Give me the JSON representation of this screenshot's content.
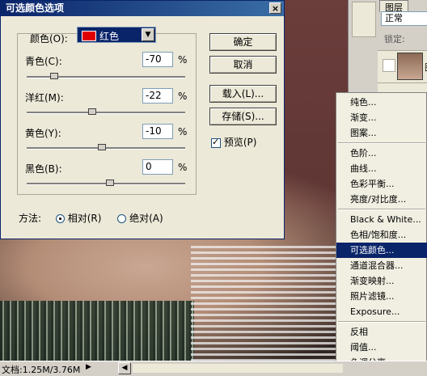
{
  "dialog": {
    "title": "可选颜色选项",
    "close": "×",
    "colors_label": "颜色(O):",
    "colors_value": "红色",
    "swatch_color": "#e00000",
    "rows": [
      {
        "label": "青色(C):",
        "value": "-70",
        "unit": "%",
        "level": -70
      },
      {
        "label": "洋红(M):",
        "value": "-22",
        "unit": "%",
        "level": -22
      },
      {
        "label": "黄色(Y):",
        "value": "-10",
        "unit": "%",
        "level": -10
      },
      {
        "label": "黑色(B):",
        "value": "0",
        "unit": "%",
        "level": 0
      }
    ],
    "buttons": {
      "ok": "确定",
      "cancel": "取消",
      "load": "载入(L)...",
      "save": "存储(S)..."
    },
    "preview_label": "预览(P)",
    "preview_checked": true,
    "method_label": "方法:",
    "method_relative": "相对(R)",
    "method_absolute": "绝对(A)",
    "method_selected": "relative"
  },
  "layers_panel": {
    "tab": "图层",
    "blend_mode": "正常",
    "lock_label": "锁定:",
    "layer_name": "图"
  },
  "adjust_menu": {
    "items": [
      {
        "label": "纯色..."
      },
      {
        "label": "渐变..."
      },
      {
        "label": "图案..."
      },
      {
        "sep": true
      },
      {
        "label": "色阶..."
      },
      {
        "label": "曲线..."
      },
      {
        "label": "色彩平衡..."
      },
      {
        "label": "亮度/对比度..."
      },
      {
        "sep": true
      },
      {
        "label": "Black & White..."
      },
      {
        "label": "色相/饱和度..."
      },
      {
        "label": "可选颜色...",
        "selected": true
      },
      {
        "label": "通道混合器..."
      },
      {
        "label": "渐变映射..."
      },
      {
        "label": "照片滤镜..."
      },
      {
        "label": "Exposure..."
      },
      {
        "sep": true
      },
      {
        "label": "反相"
      },
      {
        "label": "阈值..."
      },
      {
        "label": "色调分离..."
      }
    ]
  },
  "status": {
    "doc": "文档:1.25M/3.76M",
    "arrow": "▶",
    "nav_left": "◀"
  },
  "colors": {
    "title_bar": "#0a246a",
    "dialog_bg": "#ece9d8",
    "menu_highlight": "#0a246a"
  }
}
